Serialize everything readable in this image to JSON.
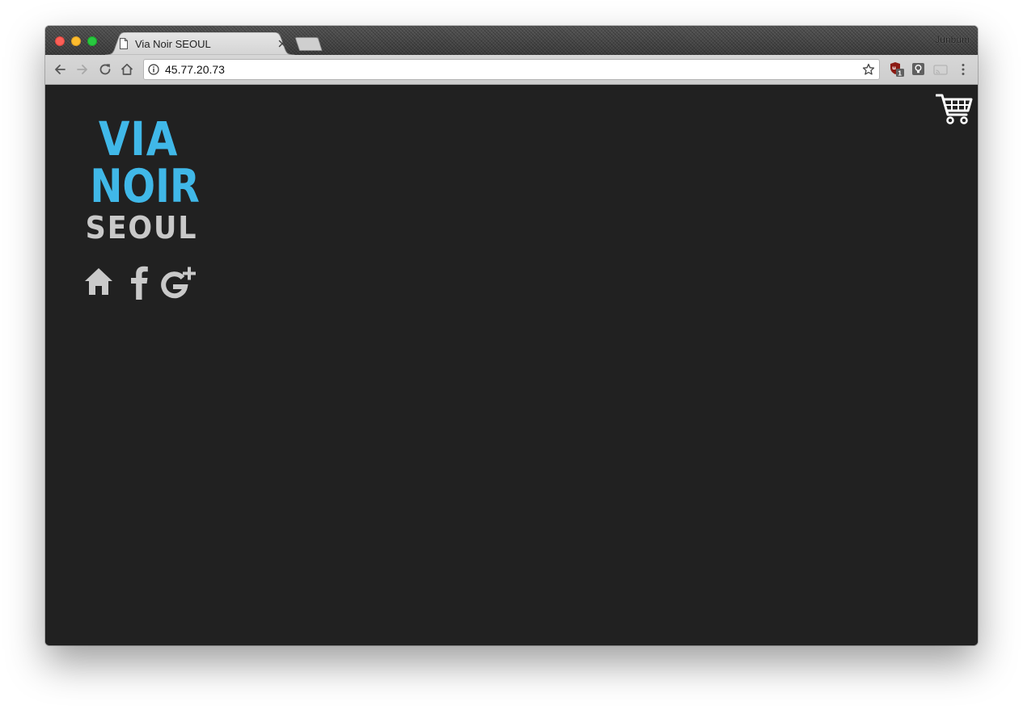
{
  "browser": {
    "tab": {
      "title": "Via Noir SEOUL"
    },
    "profile_name": "Junbum",
    "address_bar": {
      "url": "45.77.20.73"
    },
    "extensions": [
      {
        "icon": "ublock-icon",
        "badge": "1"
      },
      {
        "icon": "lightbulb-icon"
      },
      {
        "icon": "cast-icon"
      }
    ]
  },
  "page": {
    "background_color": "#212121",
    "logo": {
      "line1": "VIA",
      "line2": "NOIR",
      "line3": "SEOUL",
      "accent_color": "#40b8e8",
      "secondary_color": "#c9c9c9"
    },
    "social_links": [
      {
        "icon": "home-icon"
      },
      {
        "icon": "facebook-icon"
      },
      {
        "icon": "google-plus-icon"
      }
    ],
    "cart": {
      "icon": "shopping-cart-icon"
    }
  }
}
